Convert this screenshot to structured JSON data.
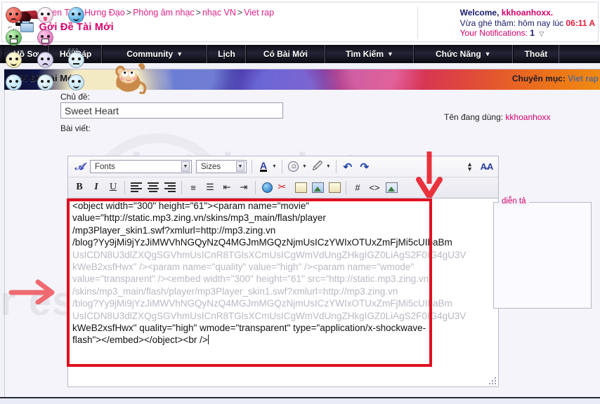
{
  "header": {
    "breadcrumb": [
      "Teen Trần Hưng Đạo",
      "Phòng âm nhạc",
      "nhạc VN",
      "Viet rap"
    ],
    "breadcrumb_sep": ">",
    "page_title": "Gởi Đề Tài Mới",
    "logo_icon": "bat-logo-icon",
    "title_icon": "new-thread-folder-icon",
    "welcome_prefix": "Welcome,",
    "welcome_user": "kkhoanhoxx.",
    "last_visit_label": "Vừa ghé thăm: hôm nay lúc",
    "last_visit_time": "06:11 A",
    "notifications_label": "Your Notifications:",
    "notifications_count": "1",
    "notifications_caret": "▽"
  },
  "nav": {
    "items": [
      {
        "label": "Hồ Sơ",
        "caret": ""
      },
      {
        "label": "Hỏi/Đáp",
        "caret": ""
      },
      {
        "label": "Community",
        "caret": "▼"
      },
      {
        "label": "Lịch",
        "caret": ""
      },
      {
        "label": "Có Bài Mới",
        "caret": ""
      },
      {
        "label": "Tìm Kiếm",
        "caret": "▼"
      },
      {
        "label": "Chức Năng",
        "caret": "▼"
      },
      {
        "label": "Thoát",
        "caret": ""
      }
    ]
  },
  "banner": {
    "title": "Gởi Đề Tài Mới",
    "category_label": "Chuyên mục:",
    "category_value": "Viet rap"
  },
  "form": {
    "subject_label": "Chủ đề:",
    "subject_value": "Sweet Heart",
    "message_label": "Bài viết:",
    "username_label": "Tên đang dùng:",
    "username_value": "kkhoanhoxx"
  },
  "toolbar": {
    "row1": {
      "remove_format_icon": "remove-formatting-icon",
      "fonts_select": "Fonts",
      "sizes_select": "Sizes",
      "font_color_icon": "font-color-icon",
      "smiley_icon": "smiley-icon",
      "attachment_icon": "paperclip-icon",
      "undo_icon": "undo-icon",
      "redo_icon": "redo-icon",
      "updown_icon": "expand-collapse-icon",
      "wysiwyg_icon": "toggle-editor-icon"
    },
    "row2": {
      "bold": "B",
      "italic": "I",
      "underline": "U",
      "align_left_icon": "align-left-icon",
      "align_center_icon": "align-center-icon",
      "align_right_icon": "align-right-icon",
      "list_ordered_icon": "ordered-list-icon",
      "list_unordered_icon": "unordered-list-icon",
      "outdent_icon": "outdent-icon",
      "indent_icon": "indent-icon",
      "link_icon": "insert-link-icon",
      "unlink_icon": "remove-link-icon",
      "email_icon": "insert-email-icon",
      "image_icon": "insert-image-icon",
      "video_icon": "insert-video-icon",
      "quote_icon": "insert-quote-icon",
      "code_icon": "insert-code-icon",
      "php_icon": "insert-php-icon"
    }
  },
  "message_body": {
    "lines": [
      {
        "text": "<object width=\"300\" height=\"61\"><param name=\"movie\"",
        "dim": false
      },
      {
        "text": "value=\"http://static.mp3.zing.vn/skins/mp3_main/flash/player",
        "dim": false
      },
      {
        "text": "/mp3Player_skin1.swf?xmlurl=http://mp3.zing.vn",
        "dim": false
      },
      {
        "text": "/blog?Yy9jMi9jYzJiMWVhNGQyNzQ4MGJmMGQzNjmUsICzYWIxOTUxZmFjMi5cUIbaBm",
        "dim": false
      },
      {
        "text": "UsICDN8U3dlZXQgSGVhmUsICnR8TGlsXCmUsICgWmVdUngZHkgIGZ0LiAgS2F0IG4gU3V",
        "dim": true
      },
      {
        "text": "kWeB2xsfHwx\" /><param name=\"quality\" value=\"high\" /><param name=\"wmode\"",
        "dim": true
      },
      {
        "text": "value=\"transparent\" /><embed width=\"300\" height=\"61\" src=\"http://static.mp3.zing.vn",
        "dim": true
      },
      {
        "text": "/skins/mp3_main/flash/player/mp3Player_skin1.swf?xmlurl=http://mp3.zing.vn",
        "dim": true
      },
      {
        "text": "/blog?Yy9jMi9jYzJiMWVhNGQyNzQ4MGJmMGQzNjmUsICzYWIxOTUxZmFjMi5cUIbaBm",
        "dim": true
      },
      {
        "text": "UsICDN8U3dlZXQgSGVhmUsICnR8TGlsXCmUsICgWmVdUngZHkgIGZ0LiAgS2F0IG4gU3V",
        "dim": true
      },
      {
        "text": "kWeB2xsfHwx\" quality=\"high\" wmode=\"transparent\" type=\"application/x-shockwave-",
        "dim": false
      },
      {
        "text": "flash\"></embed></object><br />",
        "dim": false
      }
    ],
    "resize_grip": "resize-handle"
  },
  "smiley_panel": {
    "legend": "diễn tả",
    "sticker": "monkey-sticker",
    "emoticons": [
      "angry-red-face",
      "tongue-out-face",
      "blue-wink-face",
      "green-grin-face",
      "pink-grin-face",
      "monkey-sticker",
      "yellow-smile-face",
      "lilac-sad-face",
      "sleepy-zzz-face",
      "crying-face",
      "sweat-face",
      "shocked-face"
    ]
  },
  "annotations": {
    "arrow_down": "red-arrow-down",
    "arrow_left": "red-arrow-left",
    "highlight_box": "red-highlight-box"
  },
  "watermark": {
    "text1": "photobucket",
    "text2": "r essi"
  },
  "colors": {
    "pink": "#d6006c",
    "navy": "#1a1a6e",
    "red": "#e01020",
    "nav_bg": "#14141f"
  }
}
